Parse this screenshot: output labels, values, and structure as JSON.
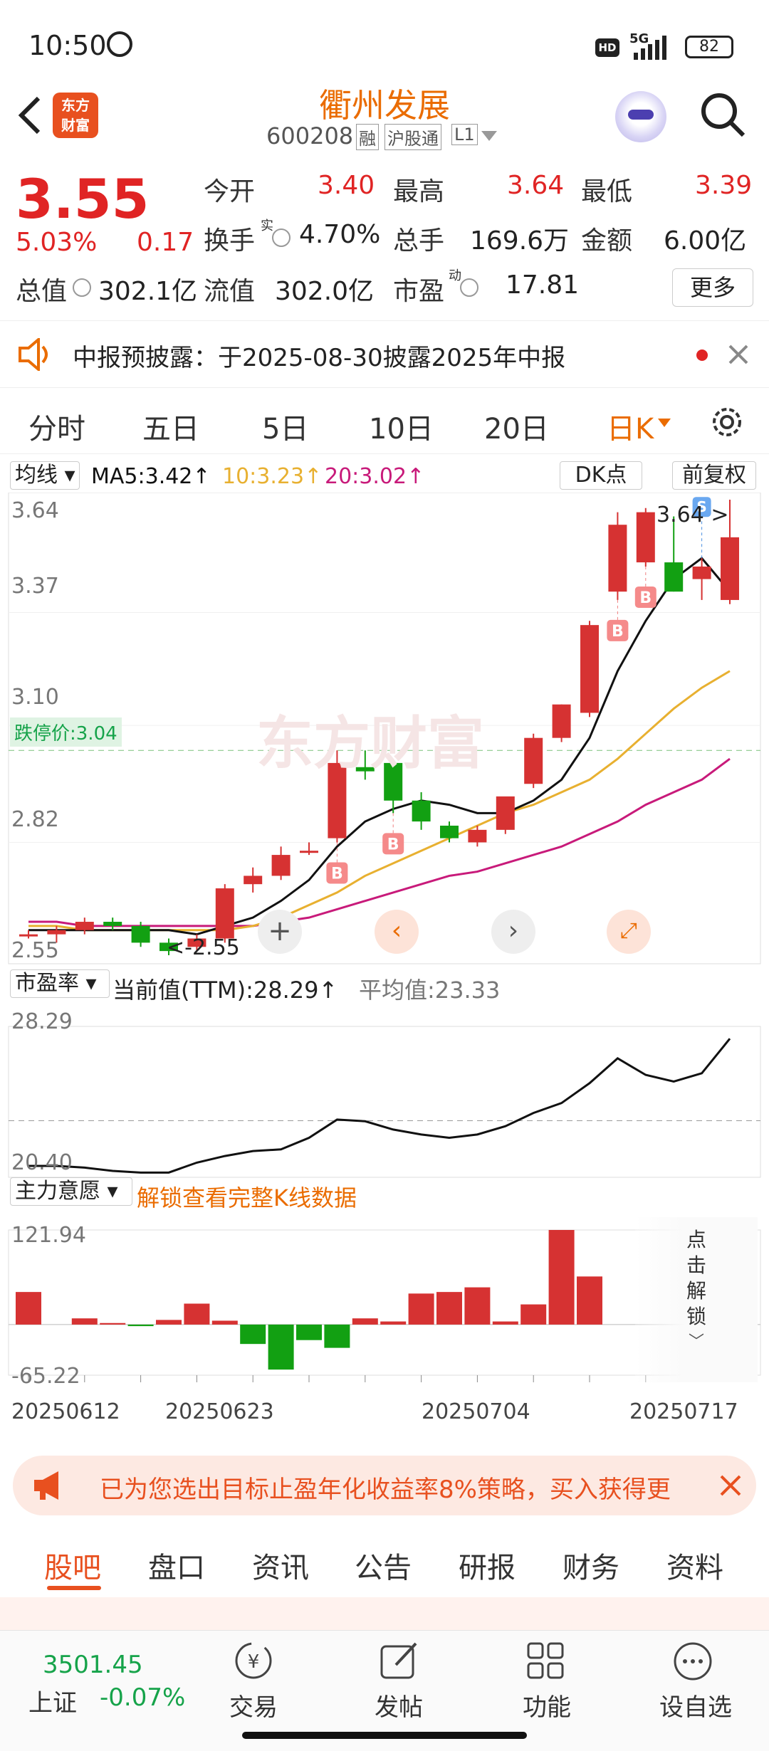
{
  "status_bar": {
    "time": "10:50",
    "network": "5G",
    "hd": "HD",
    "battery": "82"
  },
  "header": {
    "logo_line1": "东方",
    "logo_line2": "财富",
    "stock_name": "衢州发展",
    "stock_code": "600208",
    "tag_rong": "融",
    "tag_hugutong": "沪股通",
    "tag_level": "L1"
  },
  "quote": {
    "price": "3.55",
    "change_pct": "5.03%",
    "change_amt": "0.17",
    "open_label": "今开",
    "open": "3.40",
    "high_label": "最高",
    "high": "3.64",
    "low_label": "最低",
    "low": "3.39",
    "turnover_label": "换手",
    "turnover_sup": "实",
    "turnover": "4.70%",
    "volume_label": "总手",
    "volume": "169.6万",
    "amount_label": "金额",
    "amount": "6.00亿",
    "mktcap_label": "总值",
    "mktcap": "302.1亿",
    "float_label": "流值",
    "float": "302.0亿",
    "pe_label": "市盈",
    "pe_sup": "动",
    "pe": "17.81",
    "more_button": "更多"
  },
  "notice": {
    "text": "中报预披露：于2025-08-30披露2025年中报"
  },
  "period_tabs": [
    "分时",
    "五日",
    "5日",
    "10日",
    "20日",
    "日K"
  ],
  "active_tab": "日K",
  "chart": {
    "indicator_select": "均线",
    "ma5_label": "MA5:3.42",
    "ma10_label": "10:3.23",
    "ma20_label": "20:3.02",
    "dk_button": "DK点",
    "adjust_button": "前复权",
    "y_ticks": [
      "3.64",
      "3.37",
      "3.10",
      "2.82",
      "2.55"
    ],
    "limit_down_label": "跌停价:3.04",
    "max_label": "3.64",
    "min_label": "2.55",
    "watermark": "东方财富",
    "pe_select": "市盈率",
    "pe_current": "当前值(TTM):28.29",
    "pe_avg": "平均值:23.33",
    "pe_max": "28.29",
    "pe_min": "20.40",
    "flow_select": "主力意愿",
    "flow_unlock": "解锁查看完整K线数据",
    "flow_max": "121.94",
    "flow_min": "-65.22",
    "unlock_text": [
      "点",
      "击",
      "解",
      "锁"
    ],
    "dates": [
      "20250612",
      "20250623",
      "20250704",
      "20250717"
    ],
    "colors": {
      "up": "#d63232",
      "down": "#12a012",
      "ma5": "#111111",
      "ma10": "#e8b030",
      "ma20": "#c81a7a"
    }
  },
  "chart_data": {
    "type": "candlestick",
    "ohlc": [
      [
        2.6,
        2.61,
        2.59,
        2.6
      ],
      [
        2.6,
        2.62,
        2.58,
        2.61
      ],
      [
        2.61,
        2.64,
        2.6,
        2.63
      ],
      [
        2.63,
        2.64,
        2.61,
        2.62
      ],
      [
        2.62,
        2.63,
        2.57,
        2.58
      ],
      [
        2.58,
        2.59,
        2.55,
        2.56
      ],
      [
        2.57,
        2.6,
        2.56,
        2.59
      ],
      [
        2.59,
        2.72,
        2.58,
        2.71
      ],
      [
        2.72,
        2.76,
        2.7,
        2.74
      ],
      [
        2.74,
        2.81,
        2.73,
        2.79
      ],
      [
        2.8,
        2.82,
        2.79,
        2.8
      ],
      [
        2.83,
        3.04,
        2.82,
        3.01
      ],
      [
        3.0,
        3.04,
        2.97,
        2.99
      ],
      [
        3.01,
        3.01,
        2.89,
        2.92
      ],
      [
        2.92,
        2.94,
        2.85,
        2.87
      ],
      [
        2.86,
        2.87,
        2.82,
        2.83
      ],
      [
        2.82,
        2.86,
        2.81,
        2.85
      ],
      [
        2.85,
        2.91,
        2.84,
        2.93
      ],
      [
        2.96,
        3.08,
        2.95,
        3.07
      ],
      [
        3.07,
        3.15,
        3.06,
        3.15
      ],
      [
        3.13,
        3.35,
        3.12,
        3.34
      ],
      [
        3.42,
        3.61,
        3.4,
        3.58
      ],
      [
        3.49,
        3.62,
        3.48,
        3.61
      ],
      [
        3.49,
        3.6,
        3.42,
        3.42
      ],
      [
        3.45,
        3.5,
        3.4,
        3.48
      ],
      [
        3.4,
        3.64,
        3.39,
        3.55
      ]
    ],
    "ma5": [
      2.61,
      2.61,
      2.61,
      2.61,
      2.61,
      2.61,
      2.6,
      2.62,
      2.64,
      2.68,
      2.73,
      2.81,
      2.87,
      2.9,
      2.92,
      2.91,
      2.89,
      2.89,
      2.92,
      2.97,
      3.07,
      3.23,
      3.35,
      3.45,
      3.5,
      3.42
    ],
    "ma10": [
      2.62,
      2.62,
      2.61,
      2.61,
      2.61,
      2.61,
      2.61,
      2.61,
      2.62,
      2.64,
      2.67,
      2.7,
      2.74,
      2.77,
      2.8,
      2.83,
      2.86,
      2.89,
      2.91,
      2.94,
      2.97,
      3.02,
      3.08,
      3.14,
      3.19,
      3.23
    ],
    "ma20": [
      2.63,
      2.63,
      2.62,
      2.62,
      2.62,
      2.62,
      2.62,
      2.62,
      2.62,
      2.63,
      2.64,
      2.66,
      2.68,
      2.7,
      2.72,
      2.74,
      2.75,
      2.77,
      2.79,
      2.81,
      2.84,
      2.87,
      2.91,
      2.94,
      2.97,
      3.02
    ],
    "pe_series": [
      20.6,
      20.6,
      20.5,
      20.3,
      20.2,
      20.2,
      20.8,
      21.2,
      21.5,
      21.6,
      22.3,
      23.4,
      23.3,
      22.8,
      22.5,
      22.3,
      22.5,
      23.0,
      23.8,
      24.4,
      25.6,
      27.1,
      26.1,
      25.7,
      26.2,
      28.29
    ],
    "flow_series": [
      42,
      0,
      8,
      2,
      -2,
      6,
      27,
      5,
      -25,
      -58,
      -20,
      -30,
      8,
      4,
      40,
      42,
      48,
      4,
      26,
      121.94,
      62,
      0,
      0,
      0,
      0,
      0
    ],
    "buy_signals": [
      11,
      13,
      21,
      22
    ],
    "sell_signals": [
      24
    ]
  },
  "promo": {
    "text": "已为您选出目标止盈年化收益率8%策略，买入获得更"
  },
  "sub_tabs": [
    "股吧",
    "盘口",
    "资讯",
    "公告",
    "研报",
    "财务",
    "资料"
  ],
  "bottom": {
    "index_value": "3501.45",
    "index_name": "上证",
    "index_change": "-0.07%",
    "items": [
      "交易",
      "发帖",
      "功能",
      "设自选"
    ]
  }
}
